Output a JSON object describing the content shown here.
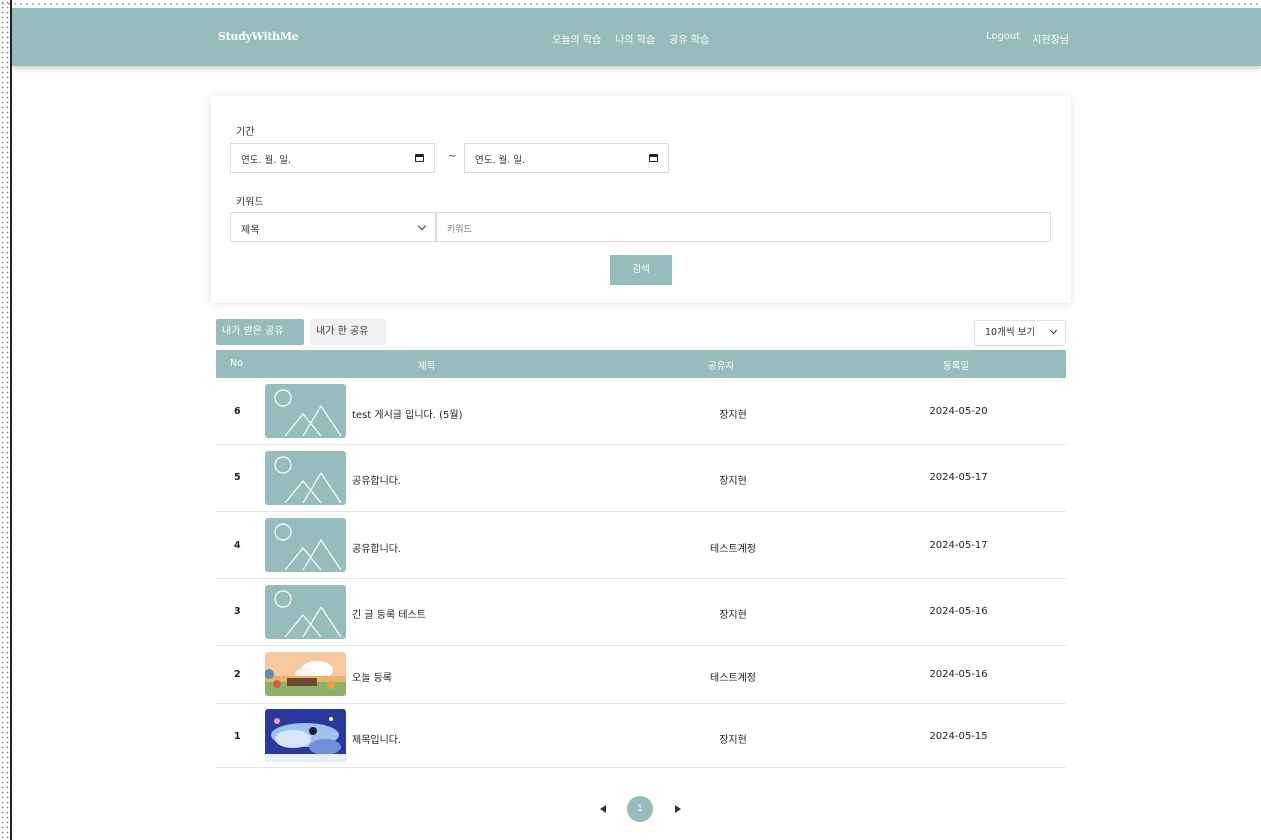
{
  "header": {
    "logo": "StudyWithMe",
    "nav": [
      "오늘의 학습",
      "나의 학습",
      "공유 학습"
    ],
    "logout": "Logout",
    "user": "지현장님"
  },
  "search": {
    "period_label": "기간",
    "date_from_placeholder": "연도. 월. 일.",
    "date_to_placeholder": "연도. 월. 일.",
    "tilde": "~",
    "keyword_label": "키워드",
    "keyword_field": "제목",
    "keyword_placeholder": "키워드",
    "search_button": "검색"
  },
  "tabs": {
    "received": "내가 받은 공유",
    "given": "내가 한 공유"
  },
  "per_page": "10개씩 보기",
  "table": {
    "headers": {
      "no": "No",
      "title": "제목",
      "sharer": "공유자",
      "date": "등록일"
    },
    "rows": [
      {
        "no": "6",
        "title": "test 게시글 입니다. (5월)",
        "sharer": "장지현",
        "date": "2024-05-20",
        "thumb": "placeholder"
      },
      {
        "no": "5",
        "title": "공유합니다.",
        "sharer": "장지현",
        "date": "2024-05-17",
        "thumb": "placeholder"
      },
      {
        "no": "4",
        "title": "공유합니다.",
        "sharer": "테스트계정",
        "date": "2024-05-17",
        "thumb": "placeholder"
      },
      {
        "no": "3",
        "title": "긴 글 등록 테스트",
        "sharer": "장지현",
        "date": "2024-05-16",
        "thumb": "placeholder"
      },
      {
        "no": "2",
        "title": "오늘 등록",
        "sharer": "테스트계정",
        "date": "2024-05-16",
        "thumb": "illustration-landscape"
      },
      {
        "no": "1",
        "title": "제목입니다.",
        "sharer": "장지현",
        "date": "2024-05-15",
        "thumb": "illustration-sky"
      }
    ]
  },
  "pagination": {
    "current": "1"
  },
  "colors": {
    "accent": "#96bcbe"
  }
}
